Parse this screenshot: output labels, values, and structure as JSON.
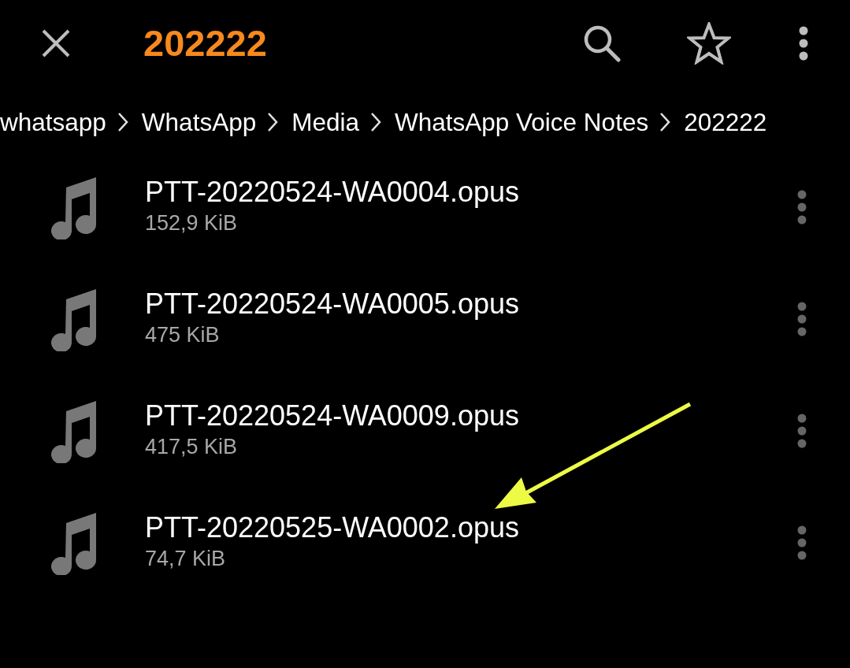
{
  "toolbar": {
    "title": "202222"
  },
  "breadcrumb": [
    {
      "label": "whatsapp"
    },
    {
      "label": "WhatsApp"
    },
    {
      "label": "Media"
    },
    {
      "label": "WhatsApp Voice Notes"
    },
    {
      "label": "202222"
    }
  ],
  "files": [
    {
      "name": "PTT-20220524-WA0004.opus",
      "size": "152,9 KiB"
    },
    {
      "name": "PTT-20220524-WA0005.opus",
      "size": "475 KiB"
    },
    {
      "name": "PTT-20220524-WA0009.opus",
      "size": "417,5 KiB"
    },
    {
      "name": "PTT-20220525-WA0002.opus",
      "size": "74,7 KiB"
    }
  ]
}
